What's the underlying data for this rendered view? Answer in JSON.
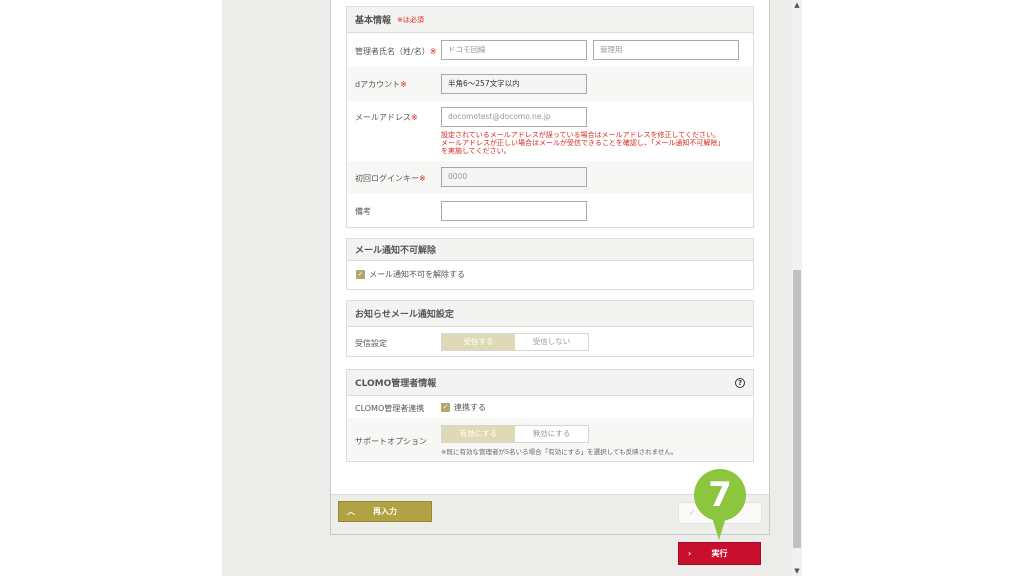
{
  "basic_info": {
    "title": "基本情報",
    "required_note": "※は必須",
    "name_label": "管理者氏名（姓/名）",
    "required_mark": "※",
    "last_name_value": "ドコモ回線",
    "first_name_value": "管理用",
    "d_account_label": "dアカウント",
    "d_account_value": "半角6～257文字以内",
    "email_label": "メールアドレス",
    "email_value": "docomotest@docomo.ne.jp",
    "email_error_line1": "設定されているメールアドレスが誤っている場合はメールアドレスを修正してください。",
    "email_error_line2": "メールアドレスが正しい場合はメールが受信できることを確認し、「メール通知不可解除」",
    "email_error_line3": "を実施してください。",
    "initial_login_label": "初回ログインキー",
    "initial_login_value": "0000",
    "remarks_label": "備考",
    "remarks_value": ""
  },
  "mail_unblock": {
    "title": "メール通知不可解除",
    "checkbox_label": "メール通知不可を解除する"
  },
  "notice_mail": {
    "title": "お知らせメール通知設定",
    "receive_label": "受信設定",
    "receive_on": "受信する",
    "receive_off": "受信しない"
  },
  "clomo_admin": {
    "title": "CLOMO管理者情報",
    "link_label": "CLOMO管理者連携",
    "link_checkbox": "連携する",
    "support_label": "サポートオプション",
    "support_on": "有効にする",
    "support_off": "無効にする",
    "support_note": "※既に有効な管理者が5名いる場合「有効にする」を選択しても反映されません。"
  },
  "footer": {
    "reenter_label": "再入力",
    "execute_label": "実行"
  },
  "callout_number": "7"
}
